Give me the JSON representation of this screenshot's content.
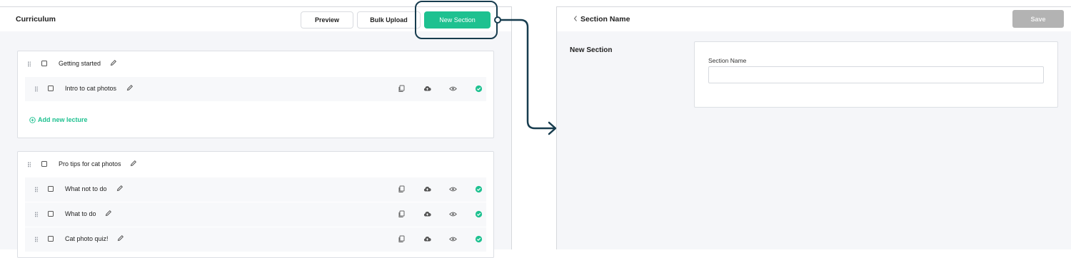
{
  "curriculum": {
    "title": "Curriculum",
    "buttons": {
      "preview": "Preview",
      "bulk_upload": "Bulk Upload",
      "new_section": "New Section"
    },
    "sections": [
      {
        "title": "Getting started",
        "lectures": [
          {
            "title": "Intro to cat photos"
          }
        ],
        "add_lecture_label": "Add new lecture"
      },
      {
        "title": "Pro tips for cat photos",
        "lectures": [
          {
            "title": "What not to do"
          },
          {
            "title": "What to do"
          },
          {
            "title": "Cat photo quiz!"
          }
        ]
      }
    ],
    "lecture_actions": [
      "copy-icon",
      "cloud-upload-icon",
      "eye-icon",
      "published-check-icon"
    ]
  },
  "section_editor": {
    "header_title": "Section Name",
    "save_label": "Save",
    "heading": "New Section",
    "field_label": "Section Name",
    "field_value": ""
  },
  "colors": {
    "accent": "#1ec190",
    "highlight": "#173c4e",
    "save_disabled": "#b3b3b3"
  }
}
